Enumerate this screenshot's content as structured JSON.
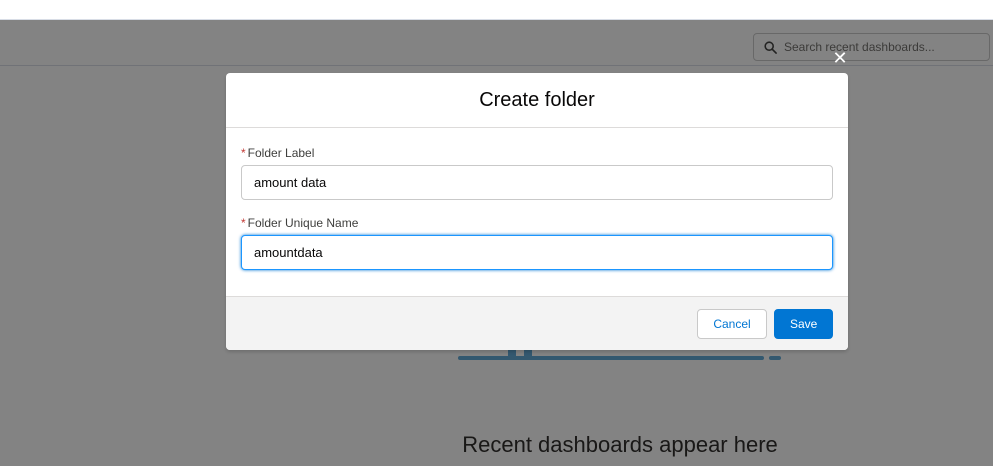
{
  "search": {
    "placeholder": "Search recent dashboards..."
  },
  "empty_state": {
    "message": "Recent dashboards appear here"
  },
  "modal": {
    "title": "Create folder",
    "close_icon": "close-icon",
    "fields": [
      {
        "label": "Folder Label",
        "required_mark": "*",
        "value": "amount data"
      },
      {
        "label": "Folder Unique Name",
        "required_mark": "*",
        "value": "amountdata"
      }
    ],
    "cancel_label": "Cancel",
    "save_label": "Save"
  },
  "colors": {
    "brand": "#0176d3",
    "required": "#c23934",
    "focus_border": "#1b96ff",
    "illustration": "#5fa8d6"
  }
}
